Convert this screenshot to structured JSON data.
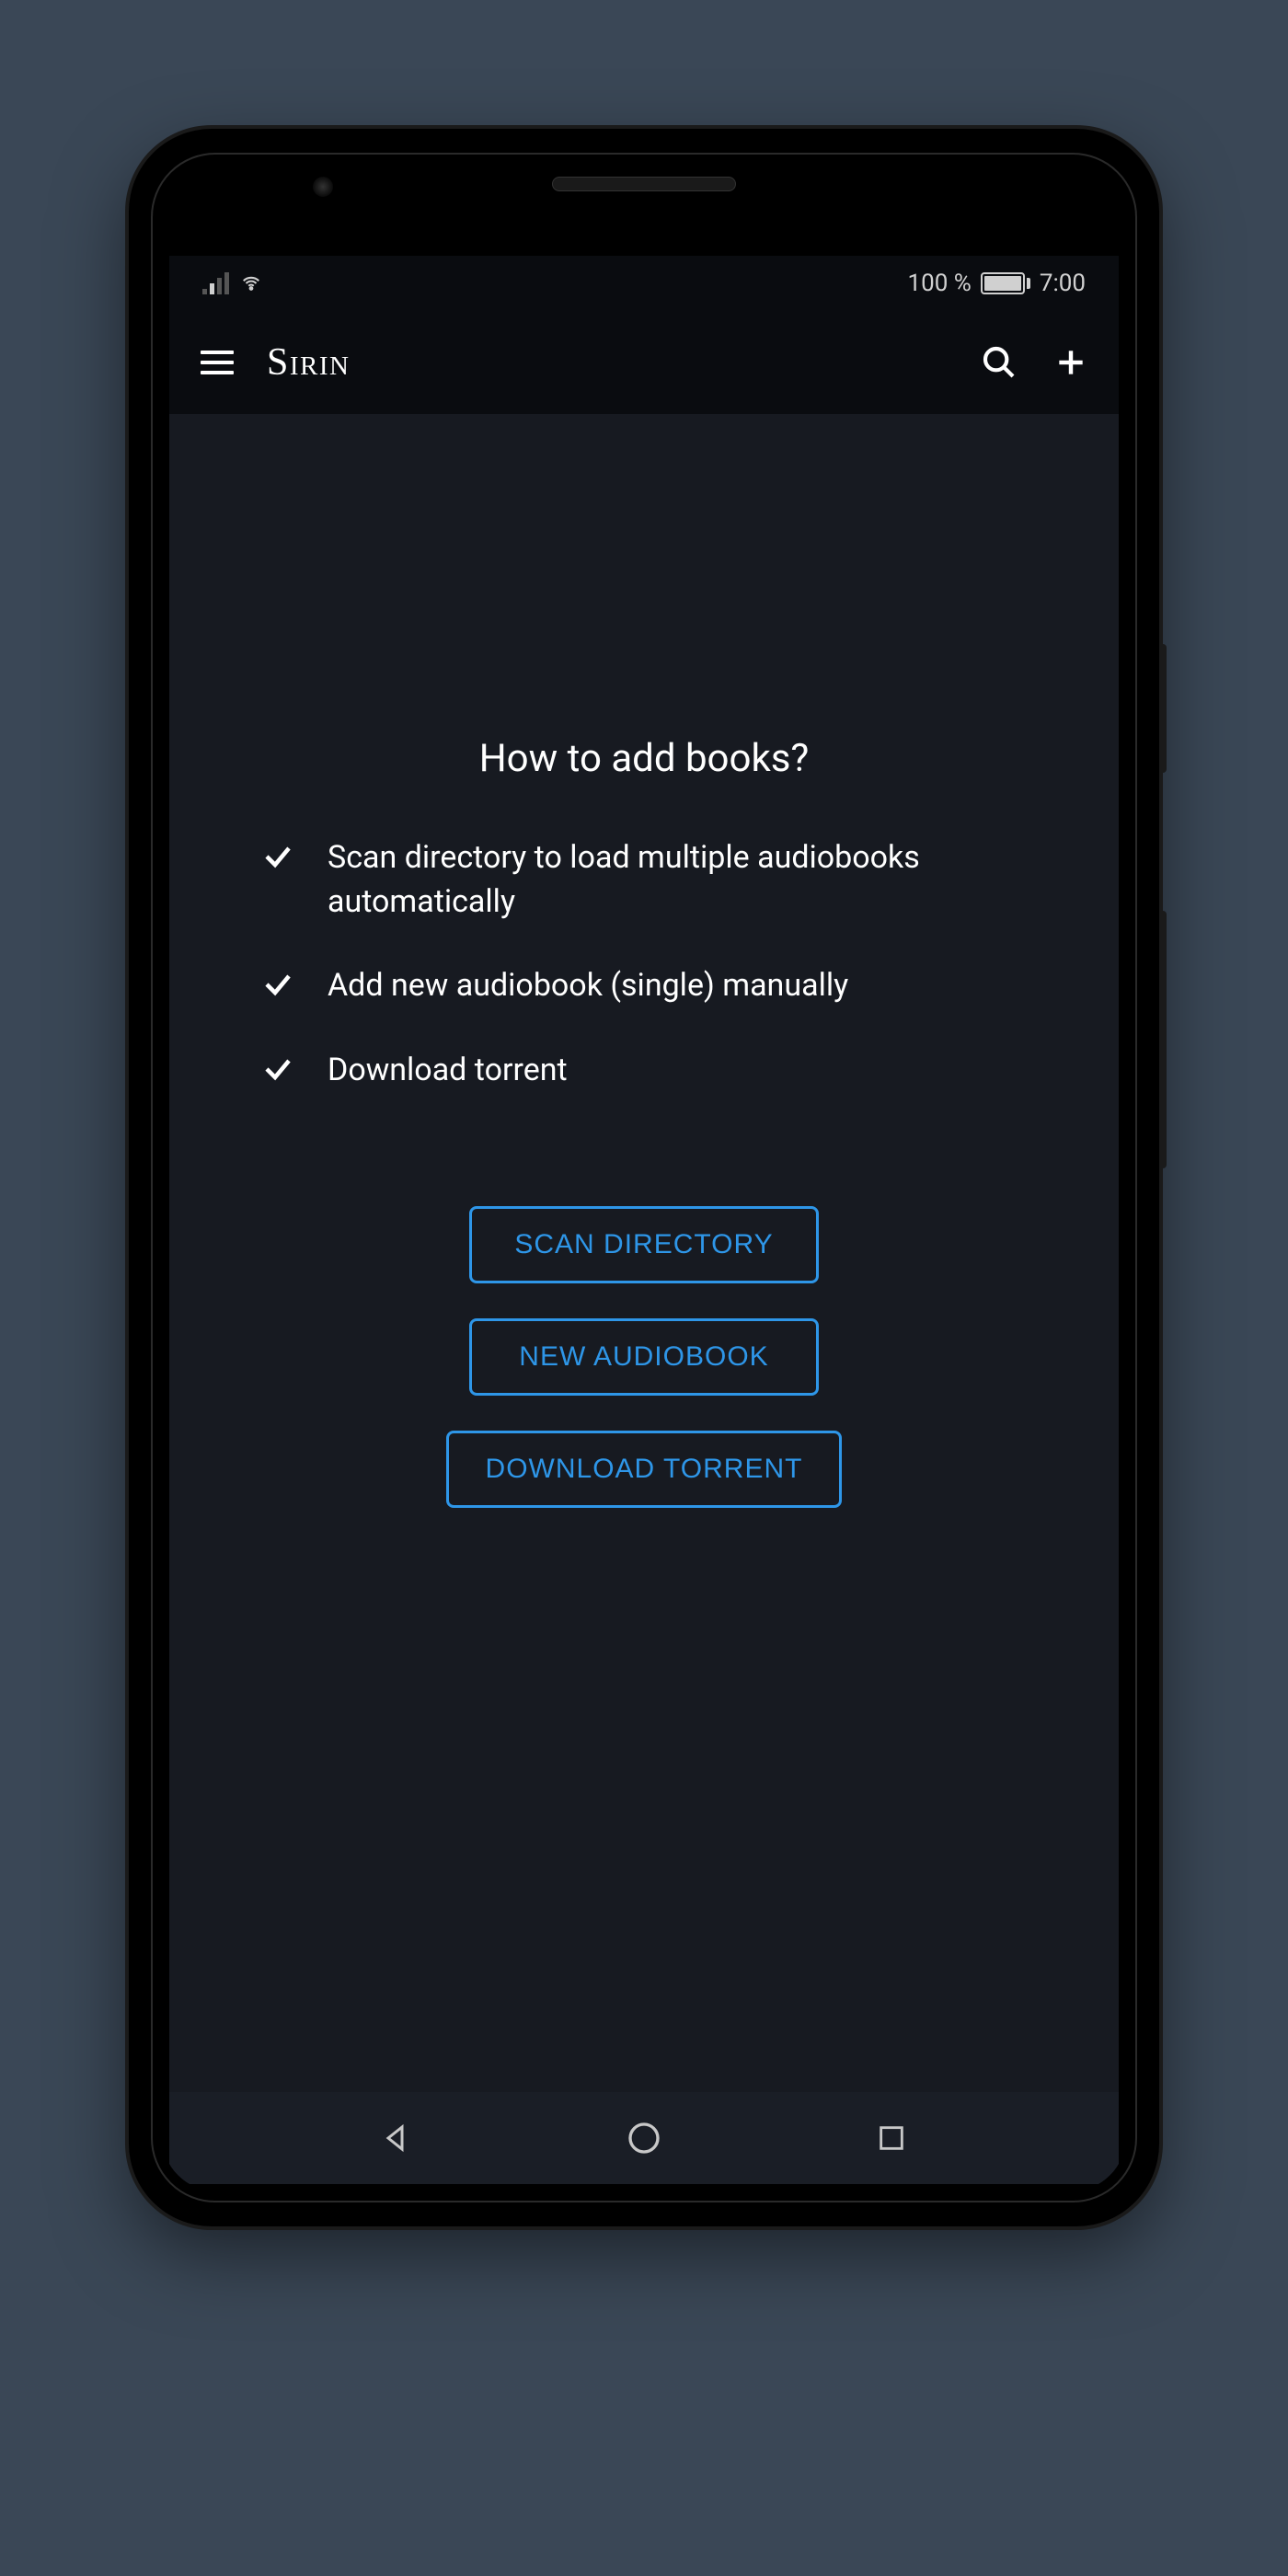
{
  "status_bar": {
    "battery_percent": "100 %",
    "time": "7:00"
  },
  "app_bar": {
    "title": "Sirin"
  },
  "content": {
    "heading": "How to add books?",
    "help_items": [
      "Scan directory to load multiple audiobooks automatically",
      "Add new audiobook (single) manually",
      "Download torrent"
    ],
    "buttons": {
      "scan": "SCAN DIRECTORY",
      "new": "NEW AUDIOBOOK",
      "download": "DOWNLOAD TORRENT"
    }
  },
  "colors": {
    "accent": "#2e96e8"
  }
}
